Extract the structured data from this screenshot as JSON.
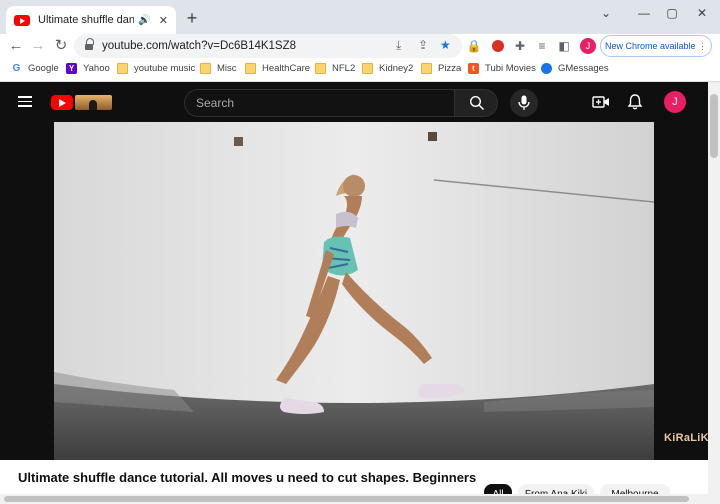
{
  "browser": {
    "tab_title": "Ultimate shuffle dance tutorial",
    "tab_audio_icon": "speaker-icon",
    "url": "youtube.com/watch?v=Dc6B14K1SZ8",
    "profile_initial": "J",
    "new_chrome_label": "New Chrome available",
    "new_chrome_more": "⋮"
  },
  "bookmarks": [
    {
      "label": "Google",
      "icon": "google-icon"
    },
    {
      "label": "Yahoo",
      "icon": "yahoo-icon"
    },
    {
      "label": "youtube music",
      "icon": "folder-icon"
    },
    {
      "label": "Misc",
      "icon": "folder-icon"
    },
    {
      "label": "HealthCare",
      "icon": "folder-icon"
    },
    {
      "label": "NFL2",
      "icon": "folder-icon"
    },
    {
      "label": "Kidney2",
      "icon": "folder-icon"
    },
    {
      "label": "Pizza",
      "icon": "folder-icon"
    },
    {
      "label": "Tubi Movies",
      "icon": "tubi-icon"
    },
    {
      "label": "GMessages",
      "icon": "messages-icon"
    }
  ],
  "youtube": {
    "search_placeholder": "Search",
    "avatar_initial": "J",
    "video_watermark": "KiRaLiK",
    "video_title": "Ultimate shuffle dance tutorial. All moves u need to cut shapes. Beginners",
    "chips": [
      "All",
      "From Ana Kiki",
      "Melbourne"
    ]
  },
  "colors": {
    "youtube_red": "#ff0000",
    "chrome_blue": "#0b57d0",
    "avatar_pink": "#e91e63"
  }
}
